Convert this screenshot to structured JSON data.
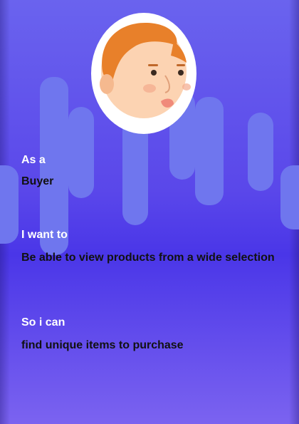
{
  "story": {
    "as_a_label": "As a",
    "role": "Buyer",
    "want_label": "I want to",
    "want": "Be able to view products from a wide selection",
    "so_label": "So i can",
    "benefit": "find unique items to purchase"
  },
  "avatar": {
    "icon": "person-face-icon"
  },
  "colors": {
    "background_top": "#6a63ee",
    "background_mid": "#4a36e8",
    "drip": "#6f76ee",
    "label": "#ffffff",
    "value": "#111111"
  }
}
